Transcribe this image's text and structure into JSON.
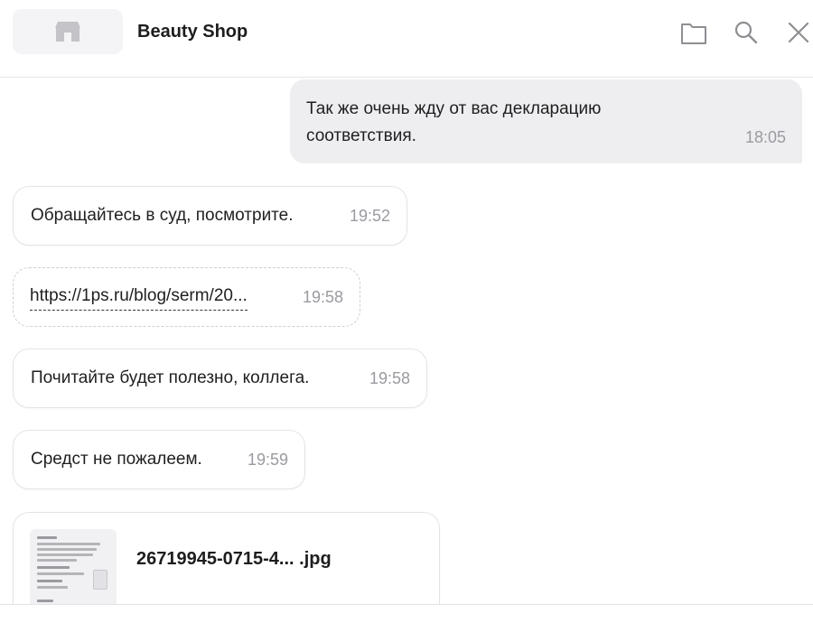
{
  "header": {
    "shop_name": "Beauty Shop",
    "icons": [
      "shop-icon",
      "folder-icon",
      "search-icon",
      "close-icon"
    ]
  },
  "messages": [
    {
      "direction": "out",
      "text_line1": "Так же очень жду от вас декларацию",
      "text_line2": "соответствия.",
      "time": "18:05"
    },
    {
      "direction": "in",
      "text": "Обращайтесь в суд, посмотрите.",
      "time": "19:52"
    },
    {
      "direction": "in",
      "type": "link",
      "text": "https://1ps.ru/blog/serm/20...",
      "time": "19:58"
    },
    {
      "direction": "in",
      "text": "Почитайте будет полезно, коллега.",
      "time": "19:58"
    },
    {
      "direction": "in",
      "text": "Средст не пожалеем.",
      "time": "19:59"
    },
    {
      "direction": "in",
      "type": "file",
      "file_name": "26719945-0715-4... .jpg"
    }
  ],
  "colors": {
    "outgoing_bubble": "#eeeef1",
    "incoming_border": "#e4e4e8",
    "time_text": "#9a9aa1",
    "icon_stroke": "#8e8e93"
  }
}
